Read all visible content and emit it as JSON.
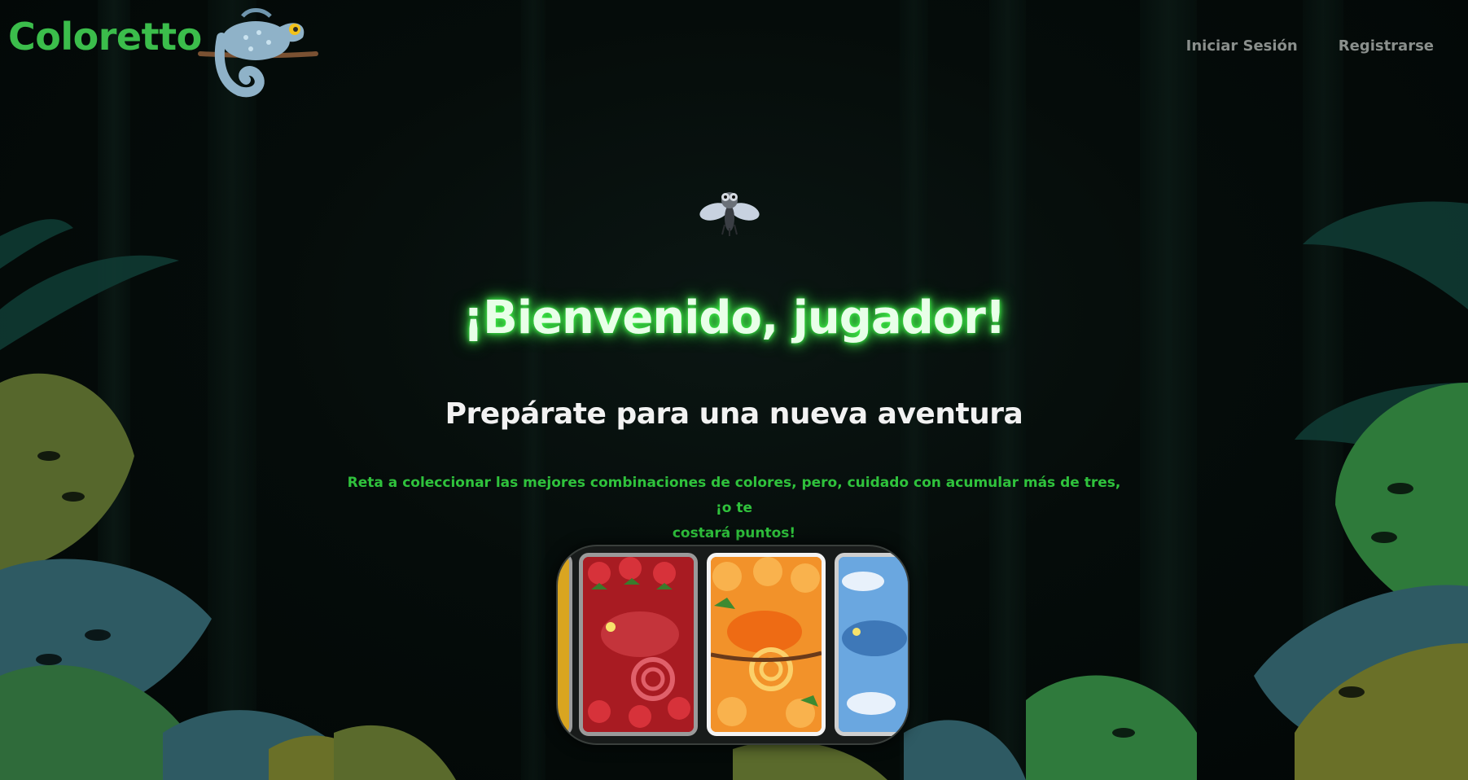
{
  "app": {
    "logo_text": "Coloretto"
  },
  "nav": {
    "login_label": "Iniciar Sesión",
    "register_label": "Registrarse"
  },
  "hero": {
    "title": "¡Bienvenido, jugador!",
    "subtitle": "Prepárate para una nueva aventura",
    "tagline_line1": "Reta a coleccionar las mejores combinaciones de colores, pero, cuidado con acumular más de tres, ¡o te",
    "tagline_line2": "costará puntos!"
  },
  "carousel": {
    "cards": [
      {
        "theme": "yellow",
        "color": "#d9a520"
      },
      {
        "theme": "red-strawberry",
        "color": "#c0262b"
      },
      {
        "theme": "orange",
        "color": "#f07a16"
      },
      {
        "theme": "blue",
        "color": "#4a86c5"
      }
    ]
  },
  "colors": {
    "brand_green": "#3bbd4b",
    "glow_green": "#3fff4a",
    "nav_gray": "#8a8f8c"
  }
}
